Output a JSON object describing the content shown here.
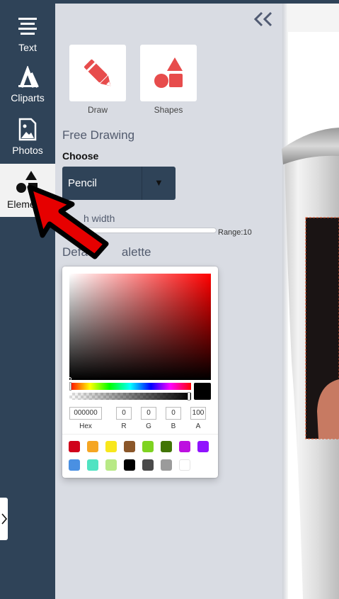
{
  "nav": {
    "items": [
      {
        "label": "Text",
        "icon": "text-lines-icon"
      },
      {
        "label": "Cliparts",
        "icon": "cliparts-icon"
      },
      {
        "label": "Photos",
        "icon": "photo-icon"
      },
      {
        "label": "Eleme",
        "icon": "elements-shapes-icon",
        "active": true
      }
    ]
  },
  "panel": {
    "tools": [
      {
        "label": "Draw",
        "icon": "pencil-icon"
      },
      {
        "label": "Shapes",
        "icon": "shapes-icon"
      }
    ],
    "free_drawing_title": "Free Drawing",
    "choose_label": "Choose",
    "brush_select_value": "Pencil",
    "brush_width_label": "h width",
    "range_label": "Range:10",
    "default_palette_title": "Defa",
    "default_palette_title_tail": "alette"
  },
  "color_picker": {
    "hex": "000000",
    "r": "0",
    "g": "0",
    "b": "0",
    "a": "100",
    "labels": {
      "hex": "Hex",
      "r": "R",
      "g": "G",
      "b": "B",
      "a": "A"
    },
    "swatches": [
      "#d0021b",
      "#f5a623",
      "#f8e71c",
      "#8b572a",
      "#7ed321",
      "#417505",
      "#bd10e0",
      "#9013fe",
      "#4a90e2",
      "#50e3c2",
      "#b8e986",
      "#000000",
      "#4a4a4a",
      "#9b9b9b",
      "#ffffff"
    ]
  },
  "colors": {
    "nav_bg": "#2f4358",
    "panel_bg": "#d9dce3",
    "accent_red": "#e74c4c",
    "overlay_arrow_red": "#e60000"
  }
}
